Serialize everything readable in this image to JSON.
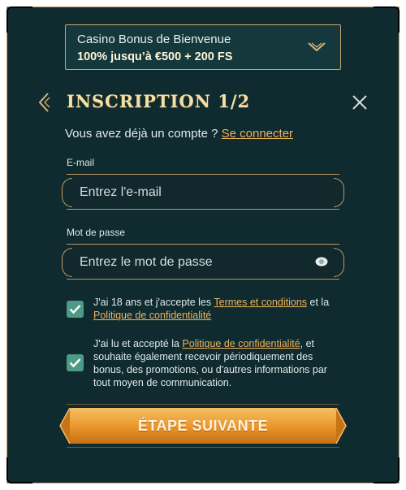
{
  "bonus": {
    "title": "Casino Bonus de Bienvenue",
    "value": "100% jusqu’à €500 + 200 FS"
  },
  "header": {
    "title": "INSCRIPTION 1/2"
  },
  "login": {
    "prompt": "Vous avez déjà un compte ?",
    "link": "Se connecter"
  },
  "form": {
    "email": {
      "label": "E-mail",
      "placeholder": "Entrez l'e-mail",
      "value": ""
    },
    "password": {
      "label": "Mot de passe",
      "placeholder": "Entrez le mot de passe",
      "value": ""
    }
  },
  "consents": [
    {
      "checked": true,
      "text_before": "J'ai 18 ans et j'accepte les",
      "link1": "Termes et conditions",
      "text_mid": "et la",
      "link2": "Politique de confidentialité",
      "text_after": ""
    },
    {
      "checked": true,
      "text_before": "J'ai lu et accepté la",
      "link1": "Politique de confidentialité",
      "text_after": ", et souhaite également recevoir périodiquement des bonus, des promotions, ou d'autres informations par tout moyen de communication."
    }
  ],
  "cta": {
    "label": "ÉTAPE SUIVANTE"
  },
  "icons": {
    "back": "chevron-left-icon",
    "close": "close-icon",
    "dropdown": "chevron-down-icon",
    "eye": "eye-icon",
    "check": "check-icon"
  },
  "colors": {
    "background": "#0f2b2f",
    "accent_gold": "#c9a46b",
    "link_orange": "#f0b35a",
    "checkbox_green": "#4d9a87",
    "cta_orange": "#e8952a"
  }
}
